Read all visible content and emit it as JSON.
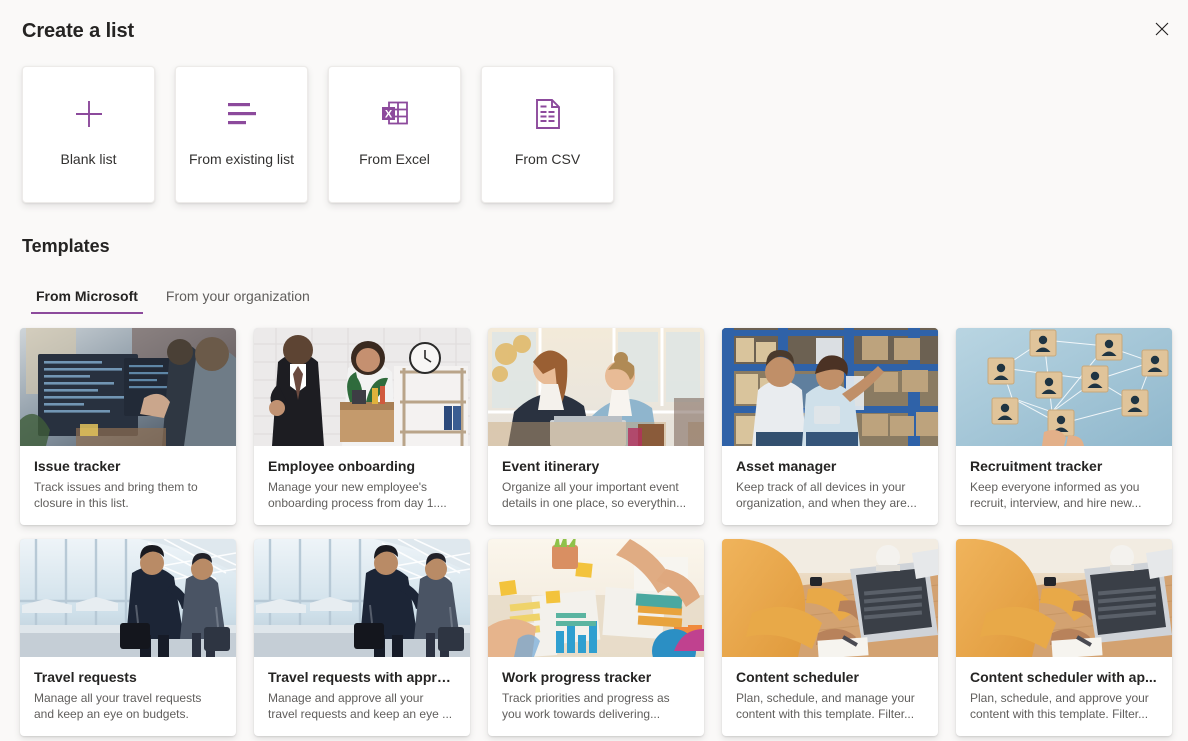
{
  "header": {
    "title": "Create a list",
    "close_label": "Close",
    "close_icon": "close-icon"
  },
  "create_options": [
    {
      "label": "Blank list",
      "icon": "plus-icon"
    },
    {
      "label": "From existing list",
      "icon": "list-lines-icon"
    },
    {
      "label": "From Excel",
      "icon": "excel-icon"
    },
    {
      "label": "From CSV",
      "icon": "csv-file-icon"
    }
  ],
  "templates_section": {
    "heading": "Templates",
    "tabs": [
      {
        "label": "From Microsoft",
        "active": true
      },
      {
        "label": "From your organization",
        "active": false
      }
    ]
  },
  "templates": [
    {
      "title": "Issue tracker",
      "description": "Track issues and bring them to closure in this list.",
      "thumb": "people-at-code-monitors"
    },
    {
      "title": "Employee onboarding",
      "description": "Manage your new employee's onboarding process from day 1....",
      "thumb": "manager-greeting-new-hire-with-box"
    },
    {
      "title": "Event itinerary",
      "description": "Organize all your important event details in one place, so everythin...",
      "thumb": "two-women-with-laptop-by-window"
    },
    {
      "title": "Asset manager",
      "description": "Keep track of all devices in your organization, and when they are...",
      "thumb": "warehouse-workers-with-tablet"
    },
    {
      "title": "Recruitment tracker",
      "description": "Keep everyone informed as you recruit, interview, and hire new...",
      "thumb": "network-of-person-icon-blocks"
    },
    {
      "title": "Travel requests",
      "description": "Manage all your travel requests and keep an eye on budgets.",
      "thumb": "travellers-with-luggage-in-airport"
    },
    {
      "title": "Travel requests with appro...",
      "description": "Manage and approve all your travel requests and keep an eye ...",
      "thumb": "travellers-with-luggage-in-airport"
    },
    {
      "title": "Work progress tracker",
      "description": "Track priorities and progress as you work towards delivering...",
      "thumb": "desk-with-colorful-charts-and-hands"
    },
    {
      "title": "Content scheduler",
      "description": "Plan, schedule, and manage your content with this template. Filter...",
      "thumb": "person-in-orange-sweater-at-laptop"
    },
    {
      "title": "Content scheduler with ap...",
      "description": "Plan, schedule, and approve your content with this template. Filter...",
      "thumb": "person-in-orange-sweater-at-laptop"
    }
  ],
  "colors": {
    "accent": "#8c4a9c",
    "page_background": "#faf9f8",
    "card_background": "#ffffff",
    "title_text": "#252423",
    "secondary_text": "#605e5c"
  }
}
